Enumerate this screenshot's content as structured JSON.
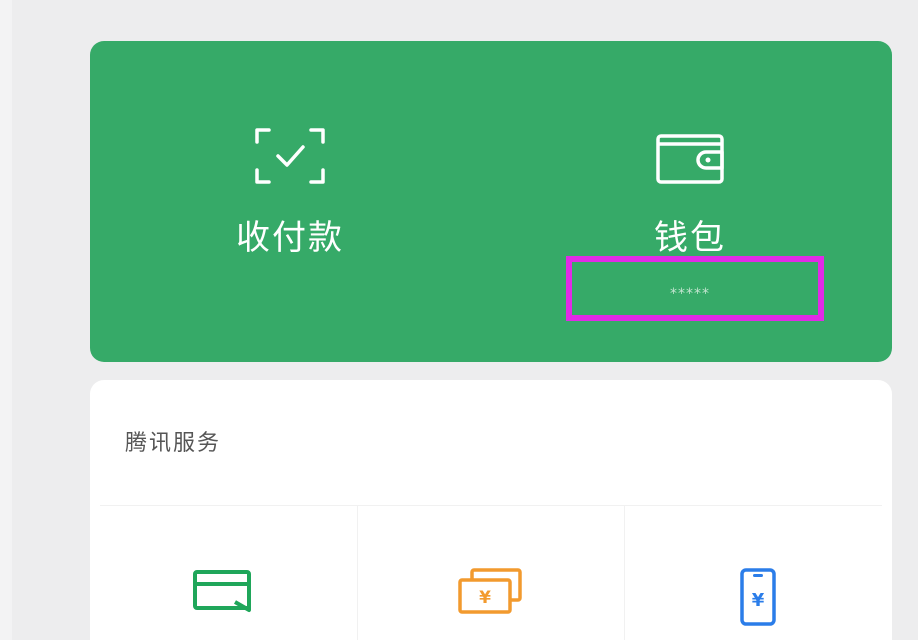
{
  "wallet_page": {
    "pay_card": {
      "receive_pay_label": "收付款",
      "wallet_label": "钱包",
      "wallet_balance_masked": "*****",
      "background_color": "#36aa68"
    },
    "services": {
      "title": "腾讯服务",
      "items": [
        {
          "icon": "card-icon",
          "color": "#1fa65a"
        },
        {
          "icon": "cash-yuan-icon",
          "color": "#f29a2e"
        },
        {
          "icon": "phone-yuan-icon",
          "color": "#2b7de9"
        }
      ]
    },
    "annotation": {
      "highlight_color": "#e02ae6"
    }
  }
}
